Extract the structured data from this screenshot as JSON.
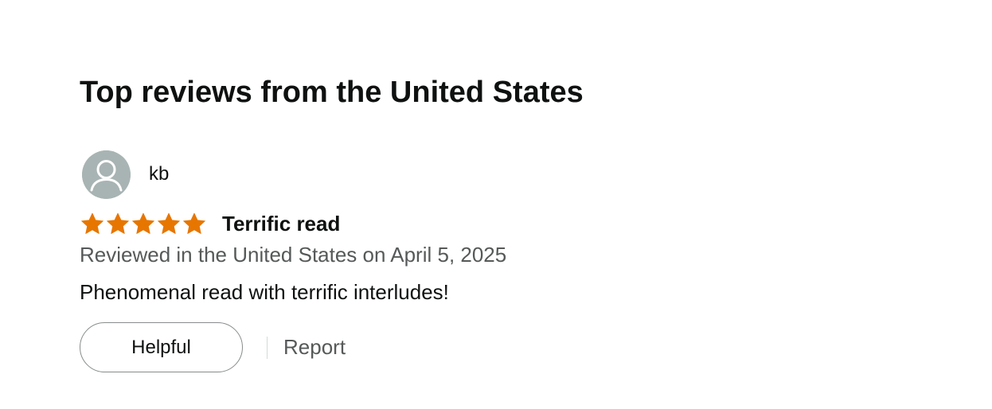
{
  "section": {
    "title": "Top reviews from the United States"
  },
  "review": {
    "profile_name": "kb",
    "avatar_icon": "user-silhouette-icon",
    "rating": 5,
    "rating_max": 5,
    "star_color": "#e77600",
    "title": "Terrific read",
    "date_text": "Reviewed in the United States on April 5, 2025",
    "body": "Phenomenal read with terrific interludes!",
    "helpful_label": "Helpful",
    "report_label": "Report"
  }
}
